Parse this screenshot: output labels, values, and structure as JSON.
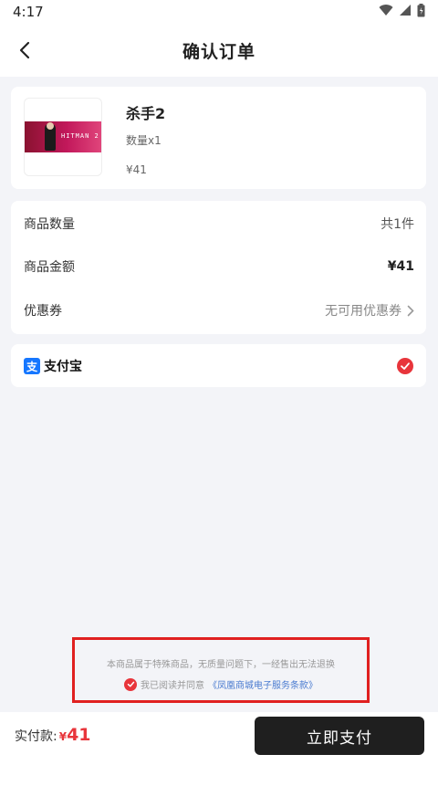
{
  "status_bar": {
    "time": "4:17"
  },
  "header": {
    "title": "确认订单"
  },
  "product": {
    "name": "杀手2",
    "quantity": "数量x1",
    "price": "¥41",
    "thumbnail_logo_text": "HITMAN 2"
  },
  "summary": {
    "rows": [
      {
        "label": "商品数量",
        "value": "共1件"
      },
      {
        "label": "商品金额",
        "value": "¥41"
      },
      {
        "label": "优惠券",
        "value": "无可用优惠券"
      }
    ]
  },
  "payment": {
    "method": "支付宝",
    "selected": true
  },
  "notice": {
    "text": "本商品属于特殊商品，无质量问题下，一经售出无法退换",
    "agree_prefix": "我已阅读并同意",
    "agree_link": "《凤凰商城电子服务条款》"
  },
  "footer": {
    "total_label": "实付款:",
    "total_currency": "¥",
    "total_value": "41",
    "pay_button": "立即支付"
  },
  "colors": {
    "accent_red": "#e8353b",
    "button_dark": "#1f1f1f",
    "link_blue": "#4a7bd0",
    "alipay_blue": "#1677ff"
  },
  "icons": [
    "wifi-icon",
    "signal-icon",
    "battery-icon",
    "back-arrow-icon",
    "chevron-right-icon",
    "alipay-icon",
    "check-icon"
  ]
}
